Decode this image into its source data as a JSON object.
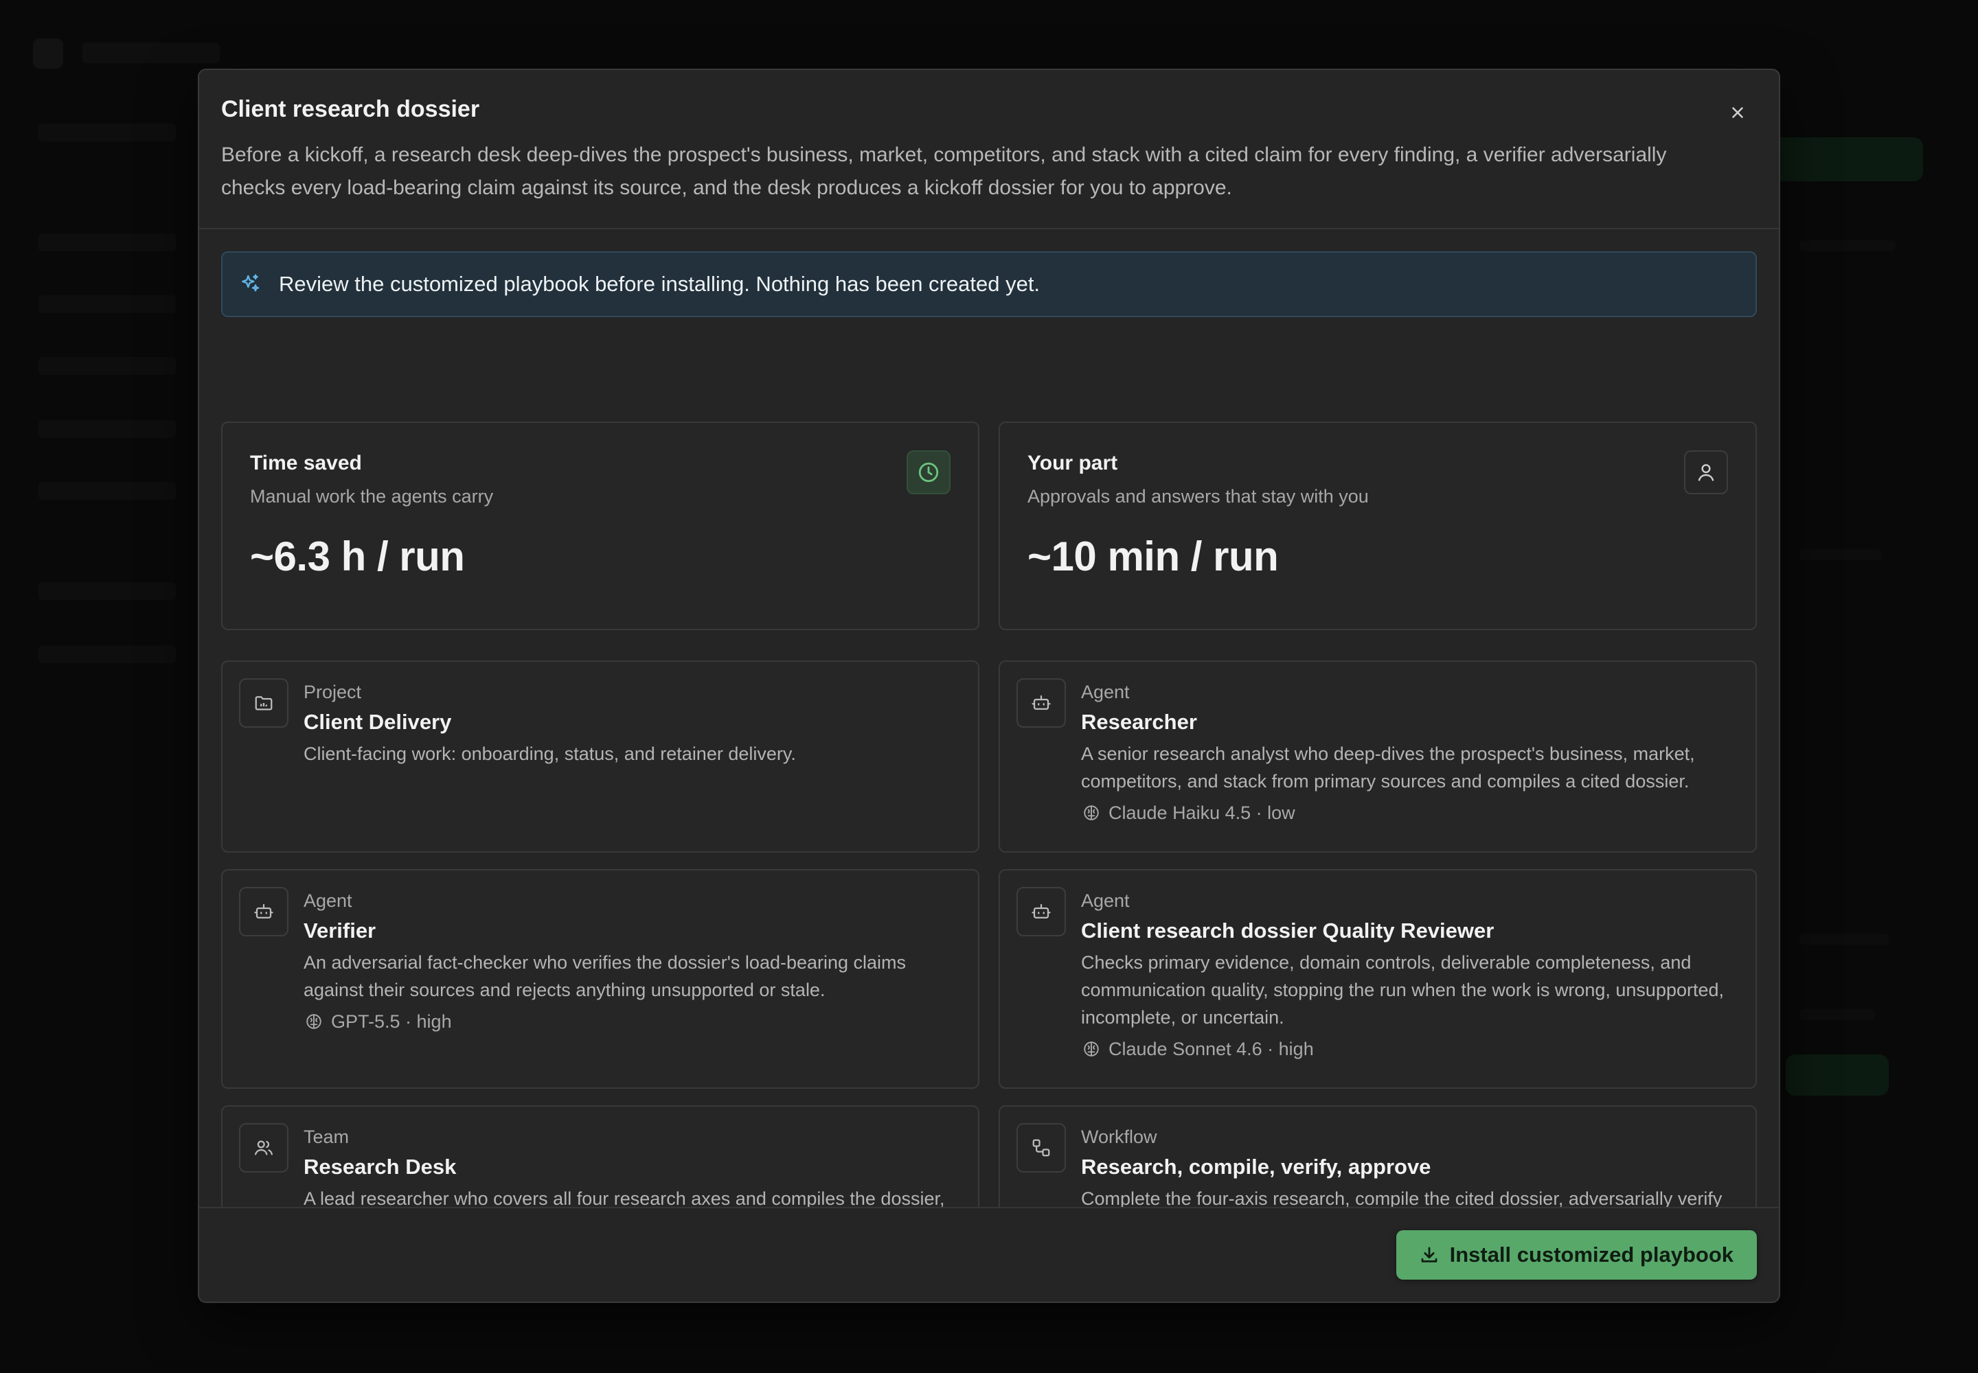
{
  "modal": {
    "title": "Client research dossier",
    "description": "Before a kickoff, a research desk deep-dives the prospect's business, market, competitors, and stack with a cited claim for every finding, a verifier adversarially checks every load-bearing claim against its source, and the desk produces a kickoff dossier for you to approve.",
    "close_icon": "close-icon"
  },
  "notice": {
    "icon": "sparkles-icon",
    "text": "Review the customized playbook before installing. Nothing has been created yet."
  },
  "stats": {
    "time_saved": {
      "title": "Time saved",
      "subtitle": "Manual work the agents carry",
      "value": "~6.3 h / run",
      "icon": "clock-icon"
    },
    "your_part": {
      "title": "Your part",
      "subtitle": "Approvals and answers that stay with you",
      "value": "~10 min / run",
      "icon": "user-icon"
    }
  },
  "items": {
    "project": {
      "kind": "Project",
      "name": "Client Delivery",
      "description": "Client-facing work: onboarding, status, and retainer delivery.",
      "icon": "folder-icon"
    },
    "researcher": {
      "kind": "Agent",
      "name": "Researcher",
      "description": "A senior research analyst who deep-dives the prospect's business, market, competitors, and stack from primary sources and compiles a cited dossier.",
      "model": "Claude Haiku 4.5 · low",
      "icon": "robot-icon"
    },
    "verifier": {
      "kind": "Agent",
      "name": "Verifier",
      "description": "An adversarial fact-checker who verifies the dossier's load-bearing claims against their sources and rejects anything unsupported or stale.",
      "model": "GPT-5.5 · high",
      "icon": "robot-icon"
    },
    "reviewer": {
      "kind": "Agent",
      "name": "Client research dossier Quality Reviewer",
      "description": "Checks primary evidence, domain controls, deliverable completeness, and communication quality, stopping the run when the work is wrong, unsupported, incomplete, or uncertain.",
      "model": "Claude Sonnet 4.6 · high",
      "icon": "robot-icon"
    },
    "team": {
      "kind": "Team",
      "name": "Research Desk",
      "description": "A lead researcher who covers all four research axes and compiles the dossier, paired with a verifier who adversarially checks every load-bearing claim against its source before anything reaches approval.",
      "icon": "users-icon"
    },
    "workflow": {
      "kind": "Workflow",
      "name": "Research, compile, verify, approve",
      "description": "Complete the four-axis research, compile the cited dossier, adversarially verify the load-bearing claims, and hand off for approval.",
      "icon": "workflow-icon"
    }
  },
  "footer": {
    "install_label": "Install customized playbook",
    "install_icon": "download-icon"
  },
  "colors": {
    "accent_green": "#58a86a",
    "notice_bg": "#22313b",
    "modal_bg": "#252525"
  }
}
